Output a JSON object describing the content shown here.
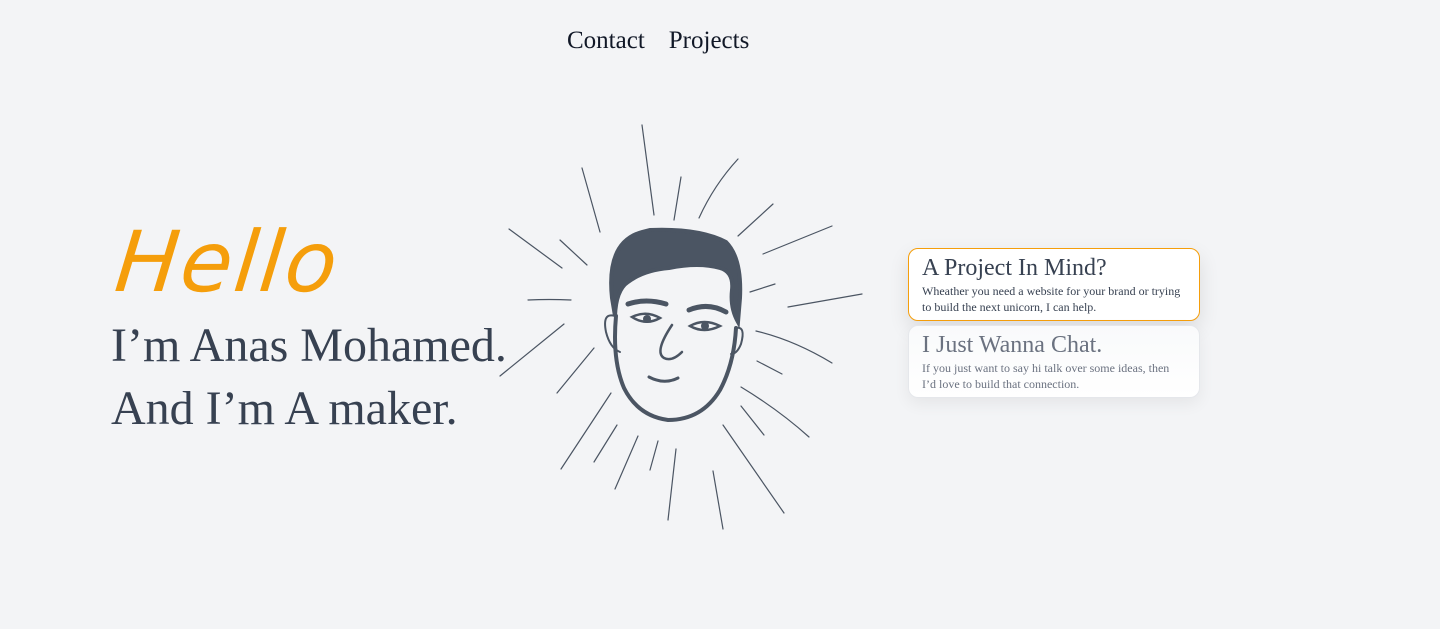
{
  "nav": {
    "contact_label": "Contact",
    "projects_label": "Projects"
  },
  "hero": {
    "greeting": "Hello",
    "line1": "I’m Anas Mohamed.",
    "line2": "And I’m A maker."
  },
  "cards": [
    {
      "title": "A Project In Mind?",
      "description": "Wheather you need a website for your brand or trying to build the next unicorn, I can help."
    },
    {
      "title": "I Just Wanna Chat.",
      "description": "If you just want to say hi talk over some ideas, then I’d love to build that connection."
    }
  ],
  "colors": {
    "accent": "#f59e0b",
    "text": "#374151",
    "background": "#f3f4f6",
    "illustration": "#4b5563"
  }
}
